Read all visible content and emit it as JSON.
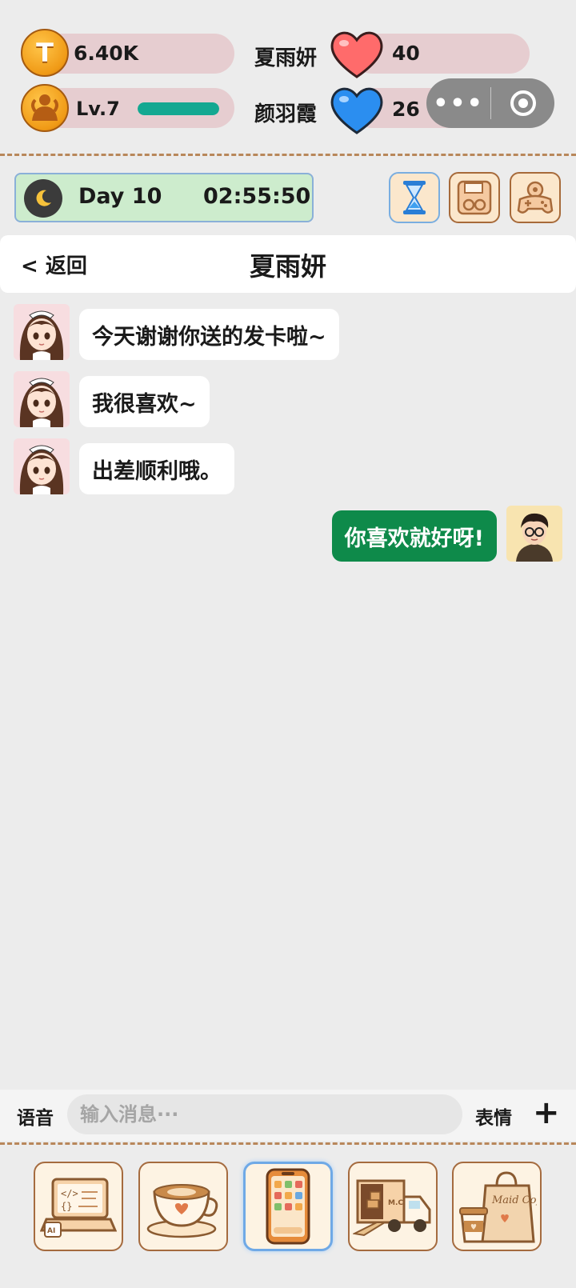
{
  "stats": {
    "coins": "6.40K",
    "coin_icon_letter": "T",
    "level": "Lv.7",
    "level_progress": 1.0
  },
  "characters": [
    {
      "name": "夏雨妍",
      "affection": "40",
      "heart_color": "#ff6b6b"
    },
    {
      "name": "颜羽霞",
      "affection": "26",
      "heart_color": "#2b8ef0"
    }
  ],
  "mini_program_capsule": {
    "menu_icon": "more-dots-icon",
    "close_icon": "target-icon"
  },
  "time": {
    "day": "Day 10",
    "clock": "02:55:50",
    "period_icon": "moon-icon"
  },
  "toolbar": {
    "icons": [
      "hourglass-icon",
      "save-disk-icon",
      "gamepad-gear-icon"
    ]
  },
  "chat": {
    "back_label": "< 返回",
    "title": "夏雨妍",
    "messages": [
      {
        "from": "her",
        "text": "今天谢谢你送的发卡啦~"
      },
      {
        "from": "her",
        "text": "我很喜欢~"
      },
      {
        "from": "her",
        "text": "出差顺利哦。"
      },
      {
        "from": "me",
        "text": "你喜欢就好呀!"
      }
    ]
  },
  "input": {
    "voice_label": "语音",
    "placeholder": "输入消息···",
    "emoji_label": "表情",
    "plus_label": "+"
  },
  "dock": {
    "items": [
      "laptop-code-icon",
      "coffee-cup-icon",
      "phone-apps-icon",
      "delivery-truck-icon",
      "maid-coffee-bag-icon"
    ],
    "active_index": 2,
    "bag_text": "Maid Coffee",
    "truck_text": "M.C"
  },
  "colors": {
    "accent_green": "#0e8a4a",
    "progress_teal": "#14a891",
    "pill_pink": "#e6cdd0",
    "day_green": "#cdeccd"
  }
}
